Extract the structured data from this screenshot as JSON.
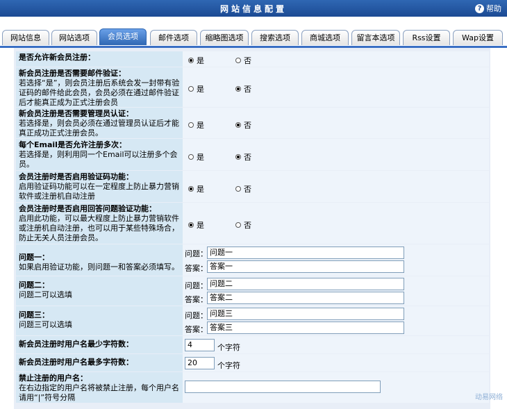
{
  "header": {
    "title": "网站信息配置",
    "help_label": "帮助"
  },
  "tabs": [
    {
      "label": "网站信息",
      "active": false
    },
    {
      "label": "网站选项",
      "active": false
    },
    {
      "label": "会员选项",
      "active": true
    },
    {
      "label": "邮件选项",
      "active": false
    },
    {
      "label": "缩略图选项",
      "active": false
    },
    {
      "label": "搜索选项",
      "active": false
    },
    {
      "label": "商城选项",
      "active": false
    },
    {
      "label": "留言本选项",
      "active": false
    },
    {
      "label": "Rss设置",
      "active": false
    },
    {
      "label": "Wap设置",
      "active": false
    }
  ],
  "options": {
    "yes": "是",
    "no": "否"
  },
  "settings": {
    "allow_register": {
      "title": "是否允许新会员注册：",
      "desc": "",
      "selected": "yes"
    },
    "email_verify": {
      "title": "新会员注册是否需要邮件验证：",
      "desc": "若选择“是”，则会员注册后系统会发一封带有验证码的邮件给此会员，会员必须在通过邮件验证后才能真正成为正式注册会员",
      "selected": "no"
    },
    "admin_verify": {
      "title": "新会员注册是否需要管理员认证：",
      "desc": "若选择是，则会员必须在通过管理员认证后才能真正成功正式注册会员。",
      "selected": "no"
    },
    "email_multi": {
      "title": "每个Email是否允许注册多次：",
      "desc": "若选择是，则利用同一个Email可以注册多个会员。",
      "selected": "no"
    },
    "captcha": {
      "title": "会员注册时是否启用验证码功能：",
      "desc": "启用验证码功能可以在一定程度上防止暴力营销软件或注册机自动注册",
      "selected": "yes"
    },
    "qa_verify": {
      "title": "会员注册时是否启用回答问题验证功能：",
      "desc": "启用此功能，可以最大程度上防止暴力营销软件或注册机自动注册，也可以用于某些特殊场合，防止无关人员注册会员。",
      "selected": "yes"
    }
  },
  "questions": [
    {
      "title": "问题一：",
      "desc": "如果启用验证功能，则问题一和答案必须填写。",
      "q_label": "问题：",
      "q_value": "问题一",
      "a_label": "答案：",
      "a_value": "答案一"
    },
    {
      "title": "问题二：",
      "desc": "问题二可以选填",
      "q_label": "问题：",
      "q_value": "问题二",
      "a_label": "答案：",
      "a_value": "答案二"
    },
    {
      "title": "问题三：",
      "desc": "问题三可以选填",
      "q_label": "问题：",
      "q_value": "问题三",
      "a_label": "答案：",
      "a_value": "答案三"
    }
  ],
  "min_length": {
    "title": "新会员注册时用户名最少字符数：",
    "value": "4",
    "unit": "个字符"
  },
  "max_length": {
    "title": "新会员注册时用户名最多字符数：",
    "value": "20",
    "unit": "个字符"
  },
  "banned_names": {
    "title": "禁止注册的用户名：",
    "desc": "在右边指定的用户名将被禁止注册，每个用户名请用“|”符号分隔",
    "value": ""
  },
  "watermark": "动易网络"
}
